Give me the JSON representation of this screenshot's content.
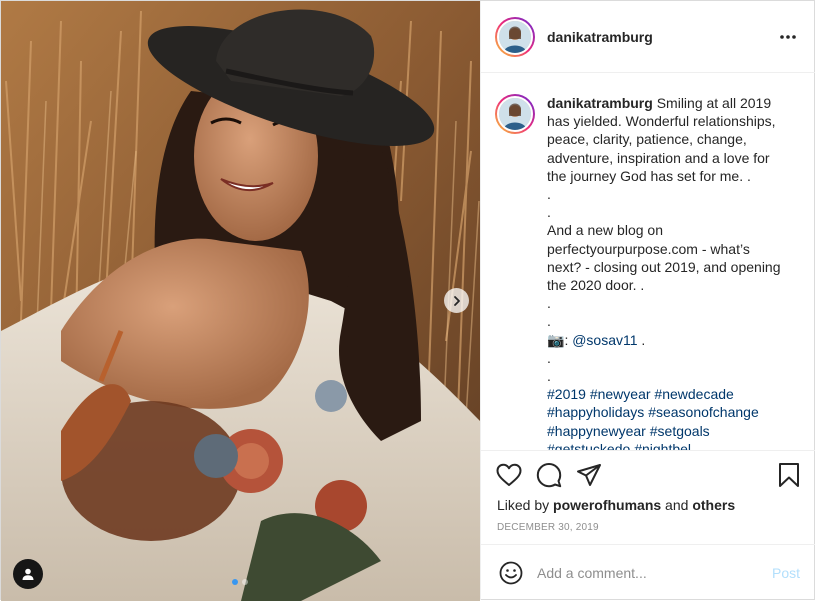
{
  "post": {
    "username": "danikatramburg",
    "caption_lines": [
      "Smiling at all 2019",
      "has yielded. Wonderful relationships,",
      "peace, clarity, patience, change,",
      "adventure, inspiration and a love for",
      "the journey God has set for me. .",
      ".",
      ".",
      "And a new blog on",
      "perfectyourpurpose.com - what’s",
      "next? - closing out 2019, and opening",
      "the 2020 door. .",
      ".",
      "."
    ],
    "camera_emoji": "📷",
    "credit_separator": ": ",
    "credit_handle": "@sosav11",
    "credit_suffix": " .",
    "after_credit_lines": [
      ".",
      "."
    ],
    "hashtag_lines": [
      [
        "#2019",
        "#newyear",
        "#newdecade"
      ],
      [
        "#happyholidays",
        "#seasonofchange"
      ],
      [
        "#happynewyear",
        "#setgoals"
      ],
      [
        "#getstuckedo",
        "#nightbel..."
      ]
    ],
    "liked_by_prefix": "Liked by ",
    "liked_by_user": "powerofhumans",
    "liked_by_and": " and ",
    "liked_by_others": "others",
    "date": "DECEMBER 30, 2019"
  },
  "comment_box": {
    "placeholder": "Add a comment...",
    "post_label": "Post"
  },
  "carousel": {
    "slide_count": 2,
    "current_index": 1
  },
  "icons": {
    "header_more": "more-horizontal-icon",
    "like": "heart-icon",
    "comment": "comment-bubble-icon",
    "share": "paper-plane-icon",
    "save": "bookmark-icon",
    "emoji": "smiley-icon",
    "next": "chevron-right-icon",
    "tags": "user-tag-icon"
  },
  "colors": {
    "link": "#00376b",
    "post_button_disabled": "#b2dffc",
    "muted_text": "#8e8e8e",
    "carousel_active_dot": "#3897f0"
  }
}
